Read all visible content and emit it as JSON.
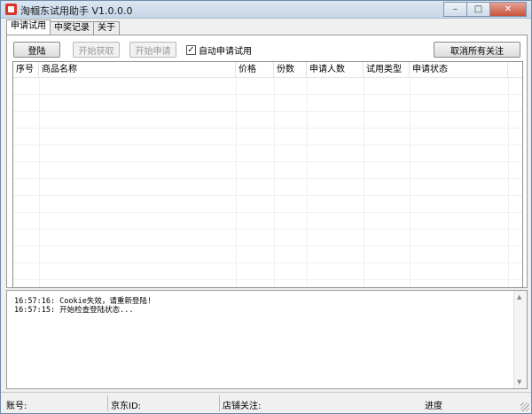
{
  "window": {
    "title": "淘帼东试用助手 V1.0.0.0"
  },
  "caption": {
    "minimize": "–",
    "maximize": "□",
    "close": "✕"
  },
  "tabs": [
    {
      "label": "申请试用",
      "active": true
    },
    {
      "label": "中奖记录",
      "active": false
    },
    {
      "label": "关于",
      "active": false
    }
  ],
  "toolbar": {
    "login_label": "登陆",
    "start_fetch_label": "开始获取",
    "start_apply_label": "开始申请",
    "auto_apply_label": "自动申请试用",
    "auto_apply_checked": true,
    "cancel_follow_label": "取消所有关注"
  },
  "table": {
    "columns": [
      "序号",
      "商品名称",
      "价格",
      "份数",
      "申请人数",
      "试用类型",
      "申请状态"
    ],
    "rows": []
  },
  "log": {
    "lines": [
      "16:57:16: Cookie失效，请重新登陆!",
      "16:57:15: 开始检查登陆状态..."
    ]
  },
  "statusbar": {
    "account_label": "账号:",
    "jd_id_label": "京东ID:",
    "shop_follow_label": "店铺关注:",
    "progress_label": "进度"
  }
}
